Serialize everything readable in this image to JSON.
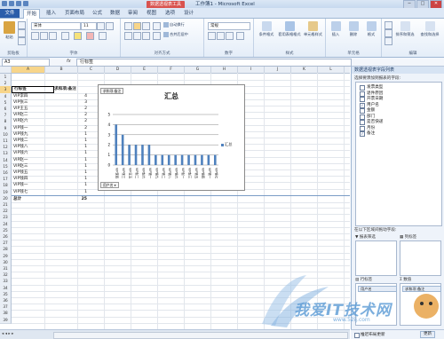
{
  "window": {
    "title": "工作簿1 - Microsoft Excel",
    "context_tab": "数据透视表工具",
    "buttons": [
      "─",
      "□",
      "✕"
    ]
  },
  "tabs": {
    "file": "文件",
    "items": [
      "开始",
      "插入",
      "页面布局",
      "公式",
      "数据",
      "审阅",
      "视图",
      "选项",
      "设计"
    ],
    "active": "开始"
  },
  "ribbon": {
    "groups": {
      "clipboard": "剪贴板",
      "font": "字体",
      "alignment": "对齐方式",
      "number": "数字",
      "styles": "样式",
      "cells": "单元格",
      "editing": "编辑"
    },
    "paste_label": "粘贴",
    "font_name": "宋体",
    "font_size": "11",
    "wrap_text": "自动换行",
    "merge_center": "合并后居中",
    "number_format": "常规",
    "conditional_format": "条件格式",
    "format_as_table": "套用表格格式",
    "cell_styles": "单元格样式",
    "insert": "插入",
    "delete": "删除",
    "format": "格式",
    "sort_filter": "排序和筛选",
    "find_select": "查找和选择"
  },
  "formula_bar": {
    "name_box": "A3",
    "fx": "fx",
    "value": "行标签"
  },
  "columns": [
    "A",
    "B",
    "C",
    "D",
    "E",
    "F",
    "G",
    "H",
    "I",
    "J",
    "K",
    "L"
  ],
  "rows": [
    "1",
    "2",
    "3",
    "4",
    "5",
    "6",
    "7",
    "8",
    "9",
    "10",
    "11",
    "12",
    "13",
    "14",
    "15",
    "16",
    "17",
    "18",
    "19",
    "20",
    "21",
    "22",
    "23",
    "24",
    "25",
    "26",
    "27",
    "28",
    "29",
    "30",
    "31",
    "32",
    "33",
    "34",
    "35",
    "36",
    "37",
    "38",
    "39"
  ],
  "pivot": {
    "header_a": "行标签",
    "header_b": "求和项:备注",
    "rows": [
      {
        "name": "VIP李四",
        "value": "4"
      },
      {
        "name": "VIP张三",
        "value": "3"
      },
      {
        "name": "VIP王五",
        "value": "2"
      },
      {
        "name": "VIP赵二",
        "value": "2"
      },
      {
        "name": "VIP赵六",
        "value": "2"
      },
      {
        "name": "VIP钱一",
        "value": "2"
      },
      {
        "name": "VIP钱九",
        "value": "1"
      },
      {
        "name": "VIP钱二",
        "value": "1"
      },
      {
        "name": "VIP钱八",
        "value": "1"
      },
      {
        "name": "VIP钱六",
        "value": "1"
      },
      {
        "name": "VIP赵一",
        "value": "1"
      },
      {
        "name": "VIP赵三",
        "value": "1"
      },
      {
        "name": "VIP钱五",
        "value": "1"
      },
      {
        "name": "VIP钱四",
        "value": "1"
      },
      {
        "name": "VIP钱一",
        "value": "1"
      },
      {
        "name": "VIP钱七",
        "value": "1"
      }
    ],
    "total_label": "总计",
    "total_value": "25"
  },
  "chart_data": {
    "type": "bar",
    "title": "汇总",
    "legend": "汇总",
    "field_button": "求和项:备注",
    "axis_button": "用户名",
    "ylim": [
      0,
      5
    ],
    "yticks": [
      "0",
      "1",
      "2",
      "3",
      "4",
      "5"
    ],
    "categories": [
      "VIP李四",
      "VIP张三",
      "VIP王五",
      "VIP赵二",
      "VIP赵六",
      "VIP钱一",
      "VIP钱九",
      "VIP钱二",
      "VIP钱八",
      "VIP钱六",
      "VIP赵一",
      "VIP赵三",
      "VIP钱五",
      "VIP钱四",
      "VIP钱一",
      "VIP钱七"
    ],
    "values": [
      4,
      3,
      2,
      2,
      2,
      2,
      1,
      1,
      1,
      1,
      1,
      1,
      1,
      1,
      1,
      1
    ],
    "bar_color": "#4f81bd"
  },
  "task_pane": {
    "title": "数据透视表字段列表",
    "choose_label": "选择要添加到报表的字段:",
    "fields": [
      {
        "name": "发票类型",
        "checked": false
      },
      {
        "name": "退件原因",
        "checked": false
      },
      {
        "name": "开票日期",
        "checked": false
      },
      {
        "name": "用户名",
        "checked": true
      },
      {
        "name": "金额",
        "checked": false
      },
      {
        "name": "部门",
        "checked": false
      },
      {
        "name": "是否快递",
        "checked": false
      },
      {
        "name": "月份",
        "checked": false
      },
      {
        "name": "备注",
        "checked": true
      }
    ],
    "drag_label": "在以下区域间拖动字段:",
    "report_filter": "报表筛选",
    "column_labels": "列标签",
    "row_labels": "行标签",
    "values": "数值",
    "row_chip": "用户名",
    "value_chip": "求和项:备注",
    "defer_update": "推迟布局更新",
    "update_button": "更新"
  },
  "watermark": "我爱IT技术网",
  "watermark_url": "www.52ij.com"
}
